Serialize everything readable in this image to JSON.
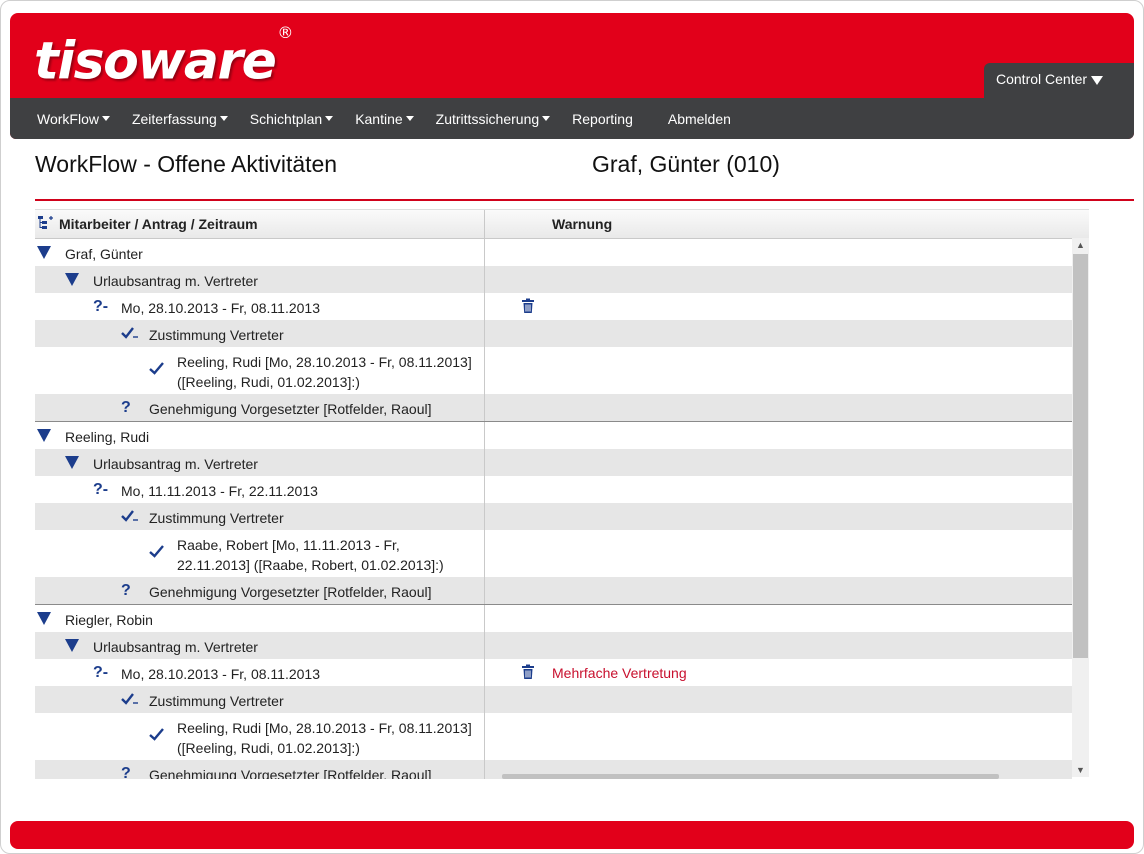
{
  "brand": {
    "logo": "tisoware",
    "registered": "®",
    "accent": "#e2001a",
    "nav_bg": "#3f4042",
    "link_blue": "#1c3d8c",
    "warning_red": "#c8102e"
  },
  "header": {
    "control_center_label": "Control Center"
  },
  "nav": {
    "items": [
      {
        "label": "WorkFlow",
        "dropdown": true
      },
      {
        "label": "Zeiterfassung",
        "dropdown": true
      },
      {
        "label": "Schichtplan",
        "dropdown": true
      },
      {
        "label": "Kantine",
        "dropdown": true
      },
      {
        "label": "Zutrittssicherung",
        "dropdown": true
      },
      {
        "label": "Reporting",
        "dropdown": false
      },
      {
        "label": "Abmelden",
        "dropdown": false
      }
    ]
  },
  "page": {
    "title": "WorkFlow - Offene Aktivitäten",
    "user": "Graf, Günter (010)"
  },
  "table": {
    "headers": {
      "col1": "Mitarbeiter / Antrag / Zeitraum",
      "col2": "Warnung"
    },
    "rows": [
      {
        "level": 0,
        "icon": "triangle-down-icon",
        "text": "Graf, Günter",
        "alt": false,
        "group": false
      },
      {
        "level": 1,
        "icon": "triangle-down-icon",
        "text": "Urlaubsantrag m. Vertreter",
        "alt": true
      },
      {
        "level": 2,
        "icon": "question-dash-icon",
        "text": "Mo, 28.10.2013 - Fr, 08.11.2013",
        "alt": false,
        "trash": true,
        "warning": ""
      },
      {
        "level": 3,
        "icon": "check-dash-icon",
        "text": "Zustimmung Vertreter",
        "alt": true
      },
      {
        "level": 4,
        "icon": "check-icon",
        "text": "Reeling, Rudi [Mo, 28.10.2013 - Fr, 08.11.2013]",
        "text2": "([Reeling, Rudi, 01.02.2013]:)",
        "alt": false
      },
      {
        "level": 3,
        "icon": "question-icon",
        "text": "Genehmigung Vorgesetzter [Rotfelder, Raoul]",
        "alt": true
      },
      {
        "level": 0,
        "icon": "triangle-down-icon",
        "text": "Reeling, Rudi",
        "alt": false,
        "group": true
      },
      {
        "level": 1,
        "icon": "triangle-down-icon",
        "text": "Urlaubsantrag m. Vertreter",
        "alt": true
      },
      {
        "level": 2,
        "icon": "question-dash-icon",
        "text": "Mo, 11.11.2013 - Fr, 22.11.2013",
        "alt": false
      },
      {
        "level": 3,
        "icon": "check-dash-icon",
        "text": "Zustimmung Vertreter",
        "alt": true
      },
      {
        "level": 4,
        "icon": "check-icon",
        "text": "Raabe, Robert [Mo, 11.11.2013 - Fr,",
        "text2": "22.11.2013] ([Raabe, Robert, 01.02.2013]:)",
        "alt": false
      },
      {
        "level": 3,
        "icon": "question-icon",
        "text": "Genehmigung Vorgesetzter [Rotfelder, Raoul]",
        "alt": true
      },
      {
        "level": 0,
        "icon": "triangle-down-icon",
        "text": "Riegler, Robin",
        "alt": false,
        "group": true
      },
      {
        "level": 1,
        "icon": "triangle-down-icon",
        "text": "Urlaubsantrag m. Vertreter",
        "alt": true
      },
      {
        "level": 2,
        "icon": "question-dash-icon",
        "text": "Mo, 28.10.2013 - Fr, 08.11.2013",
        "alt": false,
        "trash": true,
        "warning": "Mehrfache Vertretung"
      },
      {
        "level": 3,
        "icon": "check-dash-icon",
        "text": "Zustimmung Vertreter",
        "alt": true
      },
      {
        "level": 4,
        "icon": "check-icon",
        "text": "Reeling, Rudi [Mo, 28.10.2013 - Fr, 08.11.2013]",
        "text2": "([Reeling, Rudi, 01.02.2013]:)",
        "alt": false
      },
      {
        "level": 3,
        "icon": "question-icon",
        "text": "Genehmigung Vorgesetzter [Rotfelder, Raoul]",
        "alt": true
      }
    ]
  }
}
